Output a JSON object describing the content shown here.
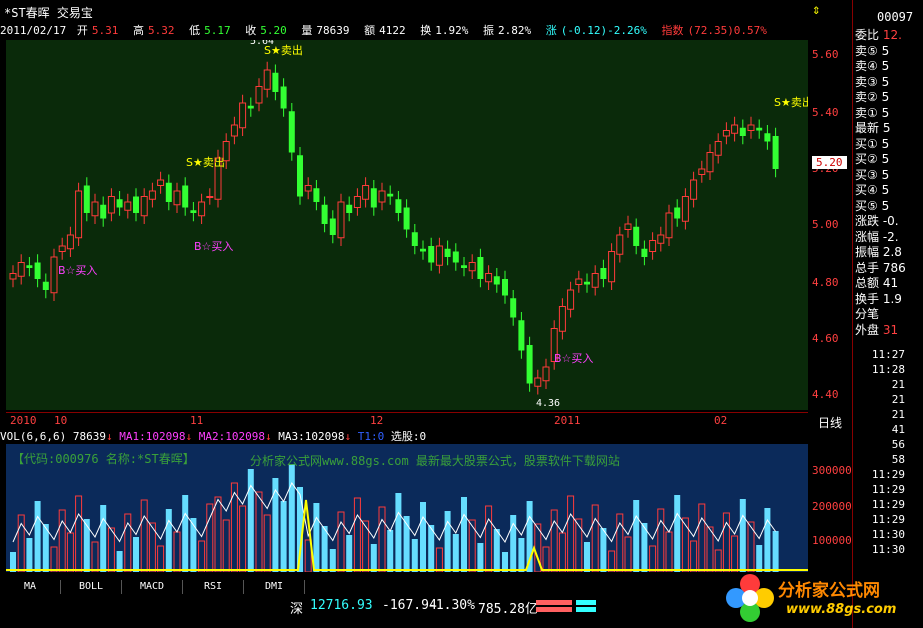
{
  "title": {
    "stock_name": "*ST春晖",
    "app": "交易宝"
  },
  "info": {
    "date": "2011/02/17",
    "open_label": "开",
    "open": "5.31",
    "high_label": "高",
    "high": "5.32",
    "low_label": "低",
    "low": "5.17",
    "close_label": "收",
    "close": "5.20",
    "vol_label": "量",
    "volume": "78639",
    "amount_label": "额",
    "amount": "4122",
    "turnover_label": "换",
    "turnover": "1.92%",
    "amp_label": "振",
    "amplitude": "2.82%",
    "chg_label": "涨",
    "change": "(-0.12)-2.26%",
    "index_label": "指数",
    "index": "(72.35)0.57%"
  },
  "price_axis": [
    "5.60",
    "5.40",
    "5.20",
    "5.00",
    "4.80",
    "4.60",
    "4.40"
  ],
  "current_price_tag": "5.20",
  "signals": {
    "sell": "S★卖出",
    "buy": "B☆买入"
  },
  "extremes": {
    "high_label": "5.64",
    "low_label": "4.36"
  },
  "x_labels": [
    "2010",
    "10",
    "11",
    "12",
    "2011",
    "02"
  ],
  "period_label": "日线",
  "volume_header": {
    "title": "VOL(6,6,6)",
    "vol": "78639",
    "ma1_label": "MA1:",
    "ma1": "102098",
    "ma2_label": "MA2:",
    "ma2": "102098",
    "ma3_label": "MA3:",
    "ma3": "102098",
    "t1": "T1:0",
    "pick": "选股:0"
  },
  "watermark": {
    "code_line": "【代码:000976 名称:*ST春晖】",
    "site_line": "分析家公式网www.88gs.com 最新最大股票公式，股票软件下载网站"
  },
  "vol_axis": [
    "300000",
    "200000",
    "100000"
  ],
  "tabs": [
    "MA",
    "BOLL",
    "MACD",
    "RSI",
    "DMI"
  ],
  "status": {
    "market": "深",
    "index_value": "12716.93",
    "change": "-167.94",
    "pct": "-1.30%",
    "amount": "785.28亿"
  },
  "right_panel": {
    "code": "00097",
    "rows": [
      {
        "label": "委比",
        "value": "12."
      },
      {
        "label": "卖⑤",
        "value": "5"
      },
      {
        "label": "卖④",
        "value": "5"
      },
      {
        "label": "卖③",
        "value": "5"
      },
      {
        "label": "卖②",
        "value": "5"
      },
      {
        "label": "卖①",
        "value": "5"
      },
      {
        "label": "最新",
        "value": "5"
      },
      {
        "label": "买①",
        "value": "5"
      },
      {
        "label": "买②",
        "value": "5"
      },
      {
        "label": "买③",
        "value": "5"
      },
      {
        "label": "买④",
        "value": "5"
      },
      {
        "label": "买⑤",
        "value": "5"
      },
      {
        "label": "涨跌",
        "value": "-0."
      },
      {
        "label": "涨幅",
        "value": "-2."
      },
      {
        "label": "振幅",
        "value": "2.8"
      },
      {
        "label": "总手",
        "value": "786"
      },
      {
        "label": "总额",
        "value": "41"
      },
      {
        "label": "换手",
        "value": "1.9"
      },
      {
        "label": "分笔",
        "value": ""
      },
      {
        "label": "外盘",
        "value": "31"
      }
    ],
    "ticks": [
      "11:27",
      "11:28",
      "21",
      "21",
      "21",
      "41",
      "56",
      "58",
      "11:29",
      "11:29",
      "11:29",
      "11:29",
      "11:30",
      "11:30"
    ]
  },
  "logo": {
    "text": "分析家公式网",
    "url": "www.88gs.com"
  },
  "colors": {
    "up": "#ff3b3b",
    "down": "#33ff33",
    "sell_signal": "#ffff00",
    "buy_signal": "#ff40ff"
  }
}
